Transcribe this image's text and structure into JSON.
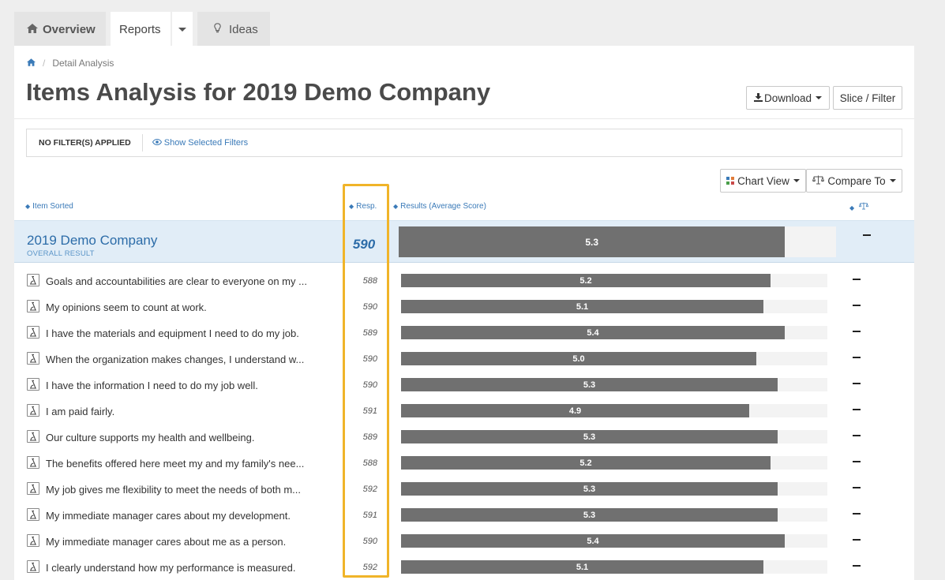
{
  "tabs": {
    "overview": "Overview",
    "reports": "Reports",
    "ideas": "Ideas"
  },
  "breadcrumb": {
    "current": "Detail Analysis"
  },
  "title": "Items Analysis for 2019 Demo Company",
  "toolbar": {
    "download": "Download",
    "slice_filter": "Slice / Filter",
    "chart_view": "Chart View",
    "compare_to": "Compare To"
  },
  "filter": {
    "status": "NO FILTER(S) APPLIED",
    "show_link": "Show Selected Filters"
  },
  "columns": {
    "item": "Item Sorted",
    "resp": "Resp.",
    "results": "Results (Average Score)"
  },
  "score_max": 6,
  "overall": {
    "name": "2019 Demo Company",
    "sub": "OVERALL RESULT",
    "resp": "590",
    "score": "5.3"
  },
  "rows": [
    {
      "label": "Goals and accountabilities are clear to everyone on my ...",
      "resp": "588",
      "score": "5.2"
    },
    {
      "label": "My opinions seem to count at work.",
      "resp": "590",
      "score": "5.1"
    },
    {
      "label": "I have the materials and equipment I need to do my job.",
      "resp": "589",
      "score": "5.4"
    },
    {
      "label": "When the organization makes changes, I understand w...",
      "resp": "590",
      "score": "5.0"
    },
    {
      "label": "I have the information I need to do my job well.",
      "resp": "590",
      "score": "5.3"
    },
    {
      "label": "I am paid fairly.",
      "resp": "591",
      "score": "4.9"
    },
    {
      "label": "Our culture supports my health and wellbeing.",
      "resp": "589",
      "score": "5.3"
    },
    {
      "label": "The benefits offered here meet my and my family's nee...",
      "resp": "588",
      "score": "5.2"
    },
    {
      "label": "My job gives me flexibility to meet the needs of both m...",
      "resp": "592",
      "score": "5.3"
    },
    {
      "label": "My immediate manager cares about my development.",
      "resp": "591",
      "score": "5.3"
    },
    {
      "label": "My immediate manager cares about me as a person.",
      "resp": "590",
      "score": "5.4"
    },
    {
      "label": "I clearly understand how my performance is measured.",
      "resp": "592",
      "score": "5.1"
    }
  ],
  "colors": {
    "accent": "#3a7ab8",
    "bar": "#707070",
    "highlight": "#f0b429"
  },
  "icons": {
    "home": "home-icon",
    "ideas": "lightbulb-icon",
    "download": "download-icon",
    "chart_view": "grid-icon",
    "compare": "balance-scale-icon",
    "row": "microscope-icon",
    "show_filters": "eye-icon"
  }
}
